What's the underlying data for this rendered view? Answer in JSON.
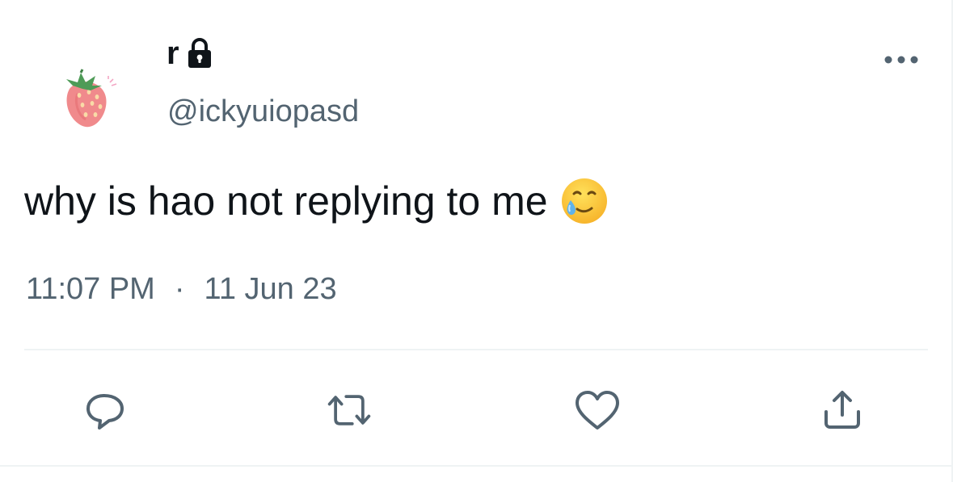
{
  "tweet": {
    "display_name": "r",
    "handle": "@ickyuiopasd",
    "text": "why is hao not replying to me",
    "time": "11:07 PM",
    "separator": "·",
    "date": "11 Jun 23"
  },
  "icons": {
    "avatar": "strawberry-avatar",
    "lock": "lock-icon",
    "more": "more-options-icon",
    "emoji": "smiling-face-with-tear-emoji",
    "reply": "reply-icon",
    "retweet": "retweet-icon",
    "like": "heart-icon",
    "share": "share-icon"
  },
  "colors": {
    "text": "#0f1419",
    "secondary": "#536471",
    "divider": "#eff3f4"
  }
}
